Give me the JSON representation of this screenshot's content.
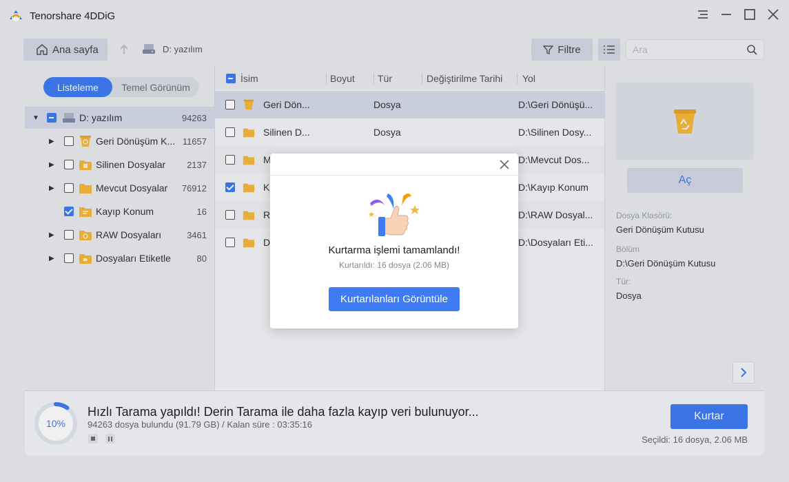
{
  "app": {
    "title": "Tenorshare 4DDiG"
  },
  "toolbar": {
    "home_label": "Ana sayfa",
    "breadcrumb_drive": "D: yazılım",
    "filter_label": "Filtre",
    "search_placeholder": "Ara"
  },
  "view_toggle": {
    "list": "Listeleme",
    "basic": "Temel Görünüm",
    "active": "Listeleme"
  },
  "tree": {
    "root": {
      "label": "D: yazılım",
      "count": "94263",
      "state": "partial"
    },
    "items": [
      {
        "label": "Geri Dönüşüm K...",
        "count": "11657",
        "state": "unchecked",
        "icon": "recycle-folder-icon"
      },
      {
        "label": "Silinen Dosyalar",
        "count": "2137",
        "state": "unchecked",
        "icon": "deleted-folder-icon"
      },
      {
        "label": "Mevcut Dosyalar",
        "count": "76912",
        "state": "unchecked",
        "icon": "folder-icon"
      },
      {
        "label": "Kayıp Konum",
        "count": "16",
        "state": "checked",
        "icon": "lost-folder-icon"
      },
      {
        "label": "RAW Dosyaları",
        "count": "3461",
        "state": "unchecked",
        "icon": "raw-folder-icon"
      },
      {
        "label": "Dosyaları Etiketle",
        "count": "80",
        "state": "unchecked",
        "icon": "tag-folder-icon"
      }
    ]
  },
  "file_list": {
    "headers": {
      "name": "İsim",
      "size": "Boyut",
      "type": "Tür",
      "modified": "Değiştirilme Tarihi",
      "path": "Yol"
    },
    "rows": [
      {
        "name": "Geri Dön...",
        "size": "",
        "type": "Dosya",
        "modified": "",
        "path": "D:\\Geri Dönüşü...",
        "checked": false
      },
      {
        "name": "Silinen D...",
        "size": "",
        "type": "Dosya",
        "modified": "",
        "path": "D:\\Silinen Dosy...",
        "checked": false
      },
      {
        "name": "M",
        "size": "",
        "type": "",
        "modified": "",
        "path": "D:\\Mevcut Dos...",
        "checked": false
      },
      {
        "name": "K",
        "size": "",
        "type": "",
        "modified": "",
        "path": "D:\\Kayıp Konum",
        "checked": true
      },
      {
        "name": "R",
        "size": "",
        "type": "",
        "modified": "",
        "path": "D:\\RAW Dosyal...",
        "checked": false
      },
      {
        "name": "D",
        "size": "",
        "type": "",
        "modified": "",
        "path": "D:\\Dosyaları Eti...",
        "checked": false
      }
    ]
  },
  "details": {
    "open_label": "Aç",
    "folder_label": "Dosya Klasörü:",
    "folder_value": "Geri Dönüşüm Kutusu",
    "section_label": "Bölüm",
    "section_value": "D:\\Geri Dönüşüm Kutusu",
    "type_label": "Tür:",
    "type_value": "Dosya"
  },
  "status": {
    "progress_percent": 10,
    "progress_label": "10%",
    "title": "Hızlı Tarama yapıldı! Derin Tarama ile daha fazla kayıp veri bulunuyor...",
    "found": "94263 dosya bulundu (91.79 GB) /  Kalan süre : 03:35:16",
    "recover_label": "Kurtar",
    "selected": "Seçildi: 16 dosya, 2.06 MB"
  },
  "dialog": {
    "title": "Kurtarma işlemi tamamlandı!",
    "subtitle": "Kurtarıldı: 16 dosya (2.06 MB)",
    "button": "Kurtarılanları Görüntüle"
  },
  "colors": {
    "accent": "#3f7cf3",
    "folder": "#f6b93b",
    "background": "#e9ebf0"
  }
}
